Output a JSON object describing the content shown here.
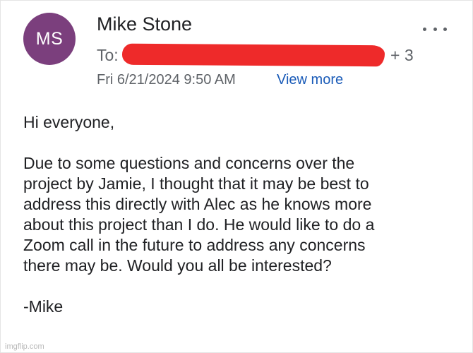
{
  "email": {
    "avatar_initials": "MS",
    "avatar_color": "#7b3f7d",
    "sender_name": "Mike Stone",
    "to_label": "To:",
    "recipient_extra_count": "+ 3",
    "date": "Fri 6/21/2024 9:50 AM",
    "view_more_label": "View more",
    "more_icon": "more-horizontal-icon",
    "body": {
      "greeting": "Hi everyone,",
      "paragraph": "Due to some questions and concerns over the\nproject by Jamie, I thought that it may be best to\naddress this directly with Alec as he knows more\nabout this project than I do. He would like to do a\nZoom call in the future to address any concerns\nthere may be. Would you all be interested?",
      "signature": "-Mike"
    }
  },
  "colors": {
    "redaction": "#ee2a2a",
    "link": "#1a5bb8"
  },
  "watermark": "imgflip.com"
}
